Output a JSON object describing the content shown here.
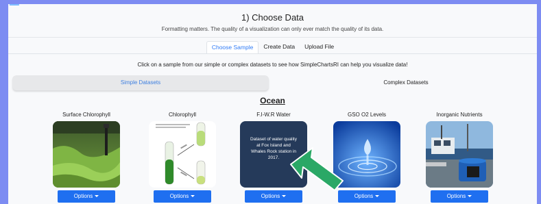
{
  "header": {
    "title": "1) Choose Data",
    "subtitle": "Formatting matters. The quality of a visualization can only ever match the quality of its data."
  },
  "tabs": [
    {
      "label": "Choose Sample",
      "active": true
    },
    {
      "label": "Create Data",
      "active": false
    },
    {
      "label": "Upload File",
      "active": false
    }
  ],
  "instruction": "Click on a sample from our simple or complex datasets to see how SimpleChartsRI can help you visualize data!",
  "dataset_types": {
    "simple": "Simple Datasets",
    "complex": "Complex Datasets",
    "selected": "simple"
  },
  "section_title": "Ocean",
  "cards": [
    {
      "title": "Surface Chlorophyll",
      "image": "green-algae-shore-image",
      "button": "Options"
    },
    {
      "title": "Chlorophyll",
      "image": "chlorophyll-lab-diagram-image",
      "button": "Options"
    },
    {
      "title": "F.I-W.R Water",
      "image": "dataset-description-image",
      "overlay_text": "Dataset of water quality at Fox Island and Whales Rock station in 2017.",
      "button": "Options"
    },
    {
      "title": "GSO O2 Levels",
      "image": "water-droplet-image",
      "button": "Options"
    },
    {
      "title": "Inorganic Nutrients",
      "image": "research-boat-image",
      "button": "Options"
    }
  ],
  "colors": {
    "background": "#7d8cf2",
    "accent": "#2f7bf6",
    "button": "#1f6ff0",
    "arrow": "#2aa866"
  }
}
